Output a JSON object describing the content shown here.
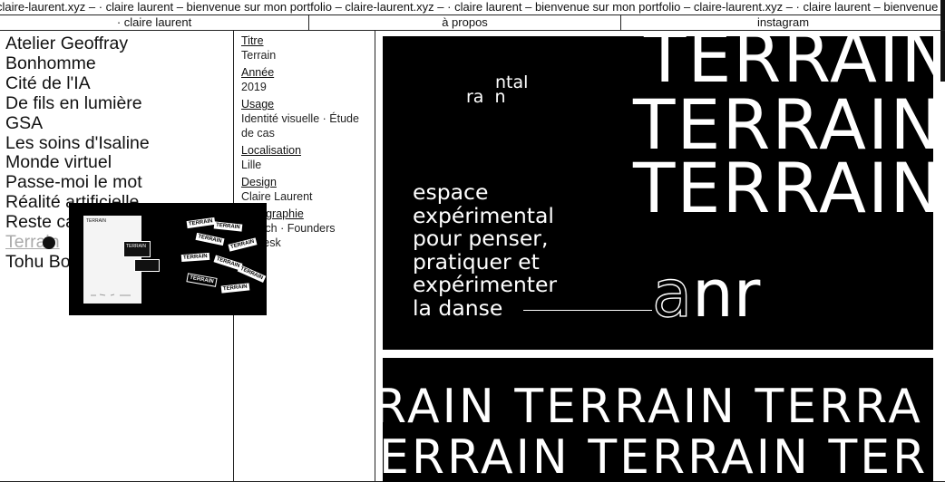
{
  "marquee": {
    "text": "claire-laurent.xyz – · claire laurent – bienvenue sur mon portfolio – claire-laurent.xyz – · claire laurent – bienvenue sur mon portfolio – claire-laurent.xyz – · claire laurent – bienvenue sur mon portfolio"
  },
  "nav": {
    "home": "· claire laurent",
    "about": "à propos",
    "instagram": "instagram"
  },
  "projects": [
    "Atelier Geoffray",
    "Bonhomme",
    "Cité de l'IA",
    "De fils en lumière",
    "GSA",
    "Les soins d'Isaline",
    "Monde virtuel",
    "Passe-moi le mot",
    "Réalité artificielle",
    "Reste calme",
    "Terrain",
    "Tohu Bohu"
  ],
  "details": {
    "title_label": "Titre",
    "title_value": "Terrain",
    "year_label": "Année",
    "year_value": "2019",
    "usage_label": "Usage",
    "usage_value": "Identité visuelle · Étude de cas",
    "location_label": "Localisation",
    "location_value": "Lille",
    "design_label": "Design",
    "design_value": "Claire Laurent",
    "typography_label": "Typographie",
    "typography_value": "Search · Founders Grotesk"
  },
  "preview": {
    "doc_title": "TERRAIN",
    "card_word": "TERRAIN"
  },
  "panel1": {
    "terrain_word": "TERRAIN",
    "logo_top": "ntal",
    "logo_bottom": "ra  n",
    "tagline": [
      "espace",
      "expérimental",
      "pour penser,",
      "pratiquer et",
      "expérimenter",
      "la danse"
    ],
    "anr_a": "a",
    "anr_rest": "nr"
  },
  "panel2": {
    "row1": "RAIN TERRAIN TERRA",
    "row2": "ERRAIN TERRAIN TER"
  }
}
